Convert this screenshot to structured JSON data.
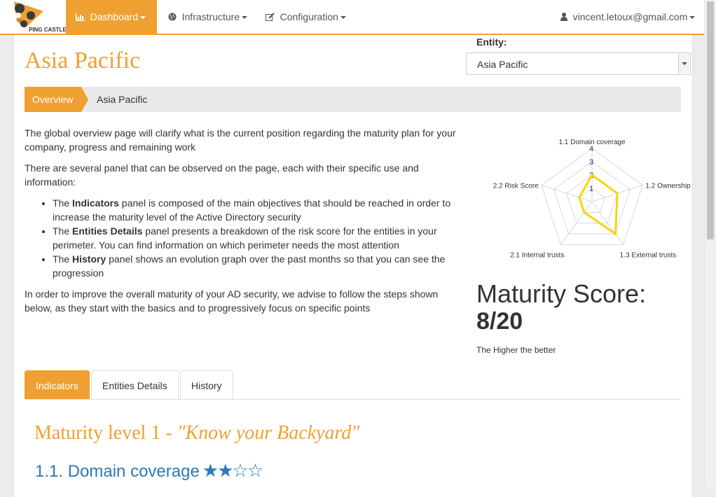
{
  "nav": {
    "logo_text": "PING CASTLE",
    "dashboard": "Dashboard",
    "infrastructure": "Infrastructure",
    "configuration": "Configuration",
    "user": "vincent.letoux@gmail.com"
  },
  "page": {
    "title": "Asia Pacific"
  },
  "entity": {
    "label": "Entity:",
    "selected": "Asia Pacific"
  },
  "breadcrumb": {
    "active": "Overview",
    "current": "Asia Pacific"
  },
  "intro": {
    "p1": "The global overview page will clarify what is the current position regarding the maturity plan for your company, progress and remaining work",
    "p2": "There are several panel that can be observed on the page, each with their specific use and information:",
    "bullets": [
      {
        "pre": "The ",
        "bold": "Indicators",
        "post": " panel is composed of the main objectives that should be reached in order to increase the maturity level of the Active Directory security"
      },
      {
        "pre": "The ",
        "bold": "Entities Details",
        "post": " panel presents a breakdown of the risk score for the entities in your perimeter. You can find information on which perimeter needs the most attention"
      },
      {
        "pre": "The ",
        "bold": "History",
        "post": " panel shows an evolution graph over the past months so that you can see the progression"
      }
    ],
    "p3": "In order to improve the overall maturity of your AD security, we advise to follow the steps shown below, as they start with the basics and to progressively focus on specific points"
  },
  "chart_data": {
    "type": "radar",
    "axes": [
      "1.1 Domain coverage",
      "1.2 Ownership",
      "1.3 External trusts",
      "2.1 Internal trusts",
      "2.2 Risk Score"
    ],
    "ticks": [
      "4",
      "3",
      "2",
      "1"
    ],
    "range": [
      0,
      4
    ],
    "values": [
      2,
      2,
      3,
      1,
      1
    ],
    "series_color": "#f5d60e",
    "grid": true
  },
  "maturity": {
    "label": "Maturity Score:",
    "value": "8/20",
    "note": "The Higher the better"
  },
  "tabs": [
    "Indicators",
    "Entities Details",
    "History"
  ],
  "level": {
    "prefix": "Maturity level 1 - ",
    "quote": "\"Know your Backyard\""
  },
  "section": {
    "title": "1.1. Domain coverage",
    "stars": "★★☆☆",
    "rating": 2,
    "rating_max": 4
  },
  "colors": {
    "accent": "#f0a030",
    "link": "#2a7ab8"
  }
}
